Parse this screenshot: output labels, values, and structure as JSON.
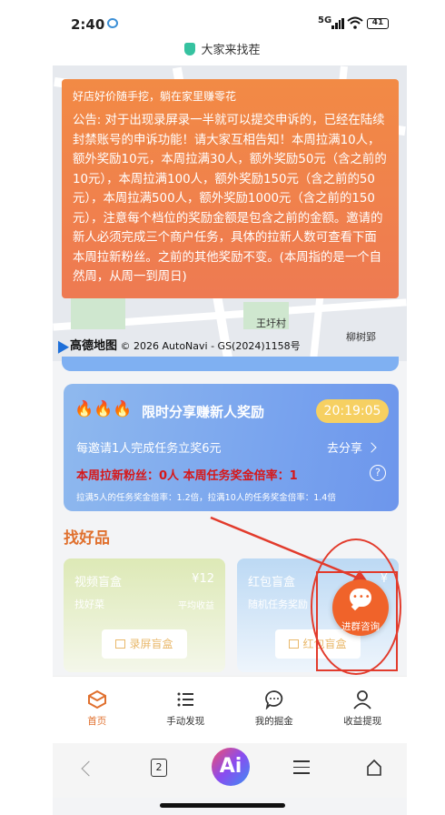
{
  "status_bar": {
    "time": "2:40",
    "network": "5G",
    "battery": "41"
  },
  "title_bar": {
    "title": "大家来找茬"
  },
  "map": {
    "place_1": "王圩村",
    "place_2": "柳树郢",
    "provider": "高德地图",
    "copyright": "© 2026 AutoNavi - GS(2024)1158号"
  },
  "notice": {
    "slogan": "好店好价随手挖，躺在家里赚零花",
    "body": "公告: 对于出现录屏录一半就可以提交申诉的，已经在陆续封禁账号的申诉功能！请大家互相告知！本周拉满10人，额外奖励10元，本周拉满30人，额外奖励50元（含之前的10元），本周拉满100人，额外奖励150元（含之前的50元），本周拉满500人，额外奖励1000元（含之前的150元），注意每个档位的奖励金额是包含之前的金额。邀请的新人必须完成三个商户任务，具体的拉新人数可查看下面本周拉新粉丝。之前的其他奖励不变。(本周指的是一个自然周，从周一到周日)"
  },
  "share_card": {
    "icons": "🔥🔥🔥",
    "title": "限时分享赚新人奖励",
    "timer": "20:19:05",
    "rule": "每邀请1人完成任务立奖6元",
    "go_share": "去分享",
    "weekly_stats": "本周拉新粉丝：0人 本周任务奖金倍率：1",
    "help": "?",
    "multiplier": "拉满5人的任务奖金倍率：1.2倍，拉满10人的任务奖金倍率：1.4倍"
  },
  "goods": {
    "title": "找好品",
    "cards": [
      {
        "name": "视频盲盒",
        "price": "¥12",
        "sub": "找好菜",
        "sub2": "平均收益",
        "button": "录屏盲盒"
      },
      {
        "name": "红包盲盒",
        "price": "¥",
        "sub": "随机任务奖励",
        "sub2": "",
        "button": "红包盲盒"
      }
    ]
  },
  "fab": {
    "label": "进群咨询"
  },
  "tabbar": [
    {
      "label": "首页",
      "icon": "home-cube-icon"
    },
    {
      "label": "手动发现",
      "icon": "list-icon"
    },
    {
      "label": "我的掘金",
      "icon": "chat-bubble-icon"
    },
    {
      "label": "收益提现",
      "icon": "person-icon"
    }
  ],
  "browser_nav": {
    "tab_count": "2",
    "ai_label": "Ai"
  },
  "colors": {
    "accent": "#e0702e",
    "notice_bg": "#f08048",
    "share_bg": "#7fa8ee",
    "fab": "#f0632a",
    "annotation": "#e23b2c"
  }
}
